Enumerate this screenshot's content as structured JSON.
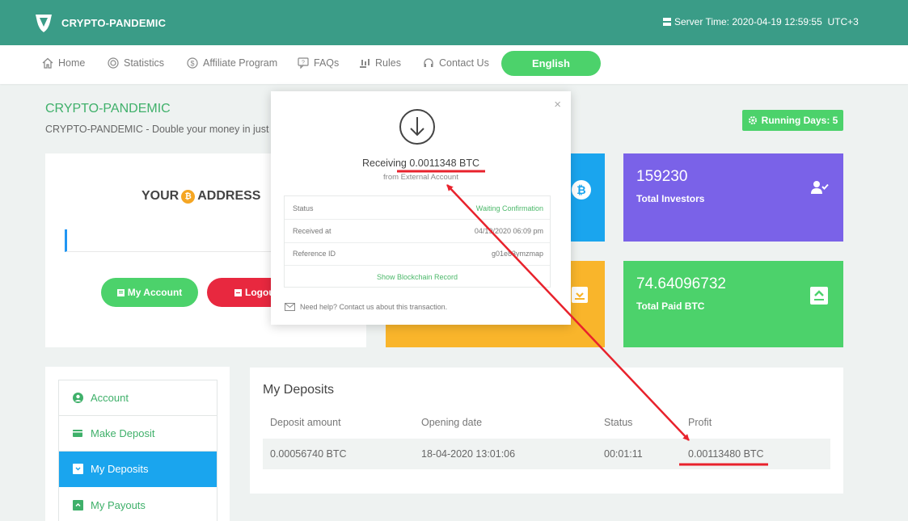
{
  "header": {
    "brand": "CRYPTO-PANDEMIC",
    "server_time": "Server Time: 2020-04-19 12:59:55",
    "timezone": "UTC+3"
  },
  "nav": {
    "items": [
      {
        "label": "Home",
        "icon": "home-icon"
      },
      {
        "label": "Statistics",
        "icon": "target-icon"
      },
      {
        "label": "Affiliate Program",
        "icon": "dollar-circle-icon"
      },
      {
        "label": "FAQs",
        "icon": "question-bubble-icon"
      },
      {
        "label": "Rules",
        "icon": "gavel-icon"
      },
      {
        "label": "Contact Us",
        "icon": "headset-icon"
      }
    ],
    "language": "English"
  },
  "page": {
    "title": "CRYPTO-PANDEMIC",
    "subtitle": "CRYPTO-PANDEMIC - Double your money in just",
    "running_days": "Running Days: 5"
  },
  "address_card": {
    "title_left": "YOUR",
    "title_right": "ADDRESS",
    "coin_symbol": "₿",
    "account_button": "My Account",
    "logout_button": "Logou"
  },
  "tiles": {
    "investors": {
      "value": "159230",
      "label": "Total Investors"
    },
    "paid": {
      "value": "74.64096732",
      "label": "Total Paid BTC"
    }
  },
  "side_menu": {
    "items": [
      {
        "label": "Account",
        "icon": "user-circle-icon",
        "active": false
      },
      {
        "label": "Make Deposit",
        "icon": "card-plus-icon",
        "active": false
      },
      {
        "label": "My Deposits",
        "icon": "download-box-icon",
        "active": true
      },
      {
        "label": "My Payouts",
        "icon": "upload-box-icon",
        "active": false
      }
    ]
  },
  "deposits": {
    "title": "My Deposits",
    "columns": [
      "Deposit amount",
      "Opening date",
      "Status",
      "Profit"
    ],
    "rows": [
      {
        "amount": "0.00056740 BTC",
        "date": "18-04-2020 13:01:06",
        "status": "00:01:11",
        "profit": "0.00113480 BTC"
      }
    ]
  },
  "modal": {
    "receiving": "Receiving 0.0011348 BTC",
    "from": "from External Account",
    "status_label": "Status",
    "status_value": "Waiting Confirmation",
    "received_label": "Received at",
    "received_value": "04/19/2020 06:09 pm",
    "ref_label": "Reference ID",
    "ref_value": "g01e83ymzmap",
    "chain_link": "Show Blockchain Record",
    "help": "Need help? Contact us about this transaction.",
    "close": "×"
  },
  "colors": {
    "header": "#3a9c87",
    "green": "#4cd26b",
    "blue": "#1aa5ee",
    "purple": "#7a62e8",
    "orange": "#f9b52b",
    "red": "#e8283f",
    "annotation": "#e8222c"
  }
}
